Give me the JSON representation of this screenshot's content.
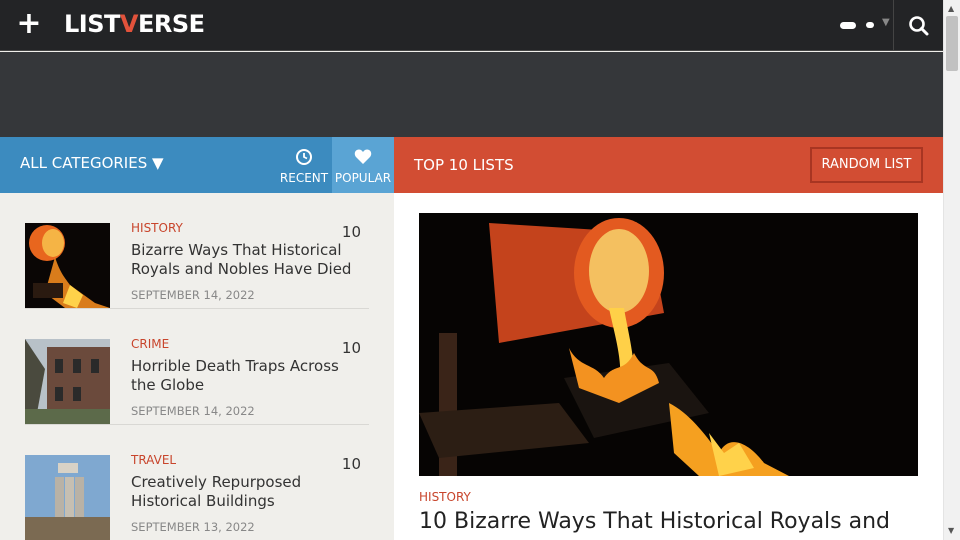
{
  "header": {
    "logo_prefix": "LIST",
    "logo_v": "V",
    "logo_suffix": "ERSE",
    "menu_icon": "plus-icon",
    "search_icon": "search-icon"
  },
  "nav": {
    "all_categories": "ALL CATEGORIES ▼",
    "recent": "RECENT",
    "popular": "POPULAR"
  },
  "featured_header": {
    "title": "TOP 10 LISTS",
    "random_button": "RANDOM LIST"
  },
  "list": [
    {
      "category": "HISTORY",
      "title": "Bizarre Ways That Historical Royals and Nobles Have Died",
      "date": "SEPTEMBER 14, 2022",
      "count": "10"
    },
    {
      "category": "CRIME",
      "title": "Horrible Death Traps Across the Globe",
      "date": "SEPTEMBER 14, 2022",
      "count": "10"
    },
    {
      "category": "TRAVEL",
      "title": "Creatively Repurposed Historical Buildings",
      "date": "SEPTEMBER 13, 2022",
      "count": "10"
    }
  ],
  "featured": {
    "category": "HISTORY",
    "title": "10 Bizarre Ways That Historical Royals and"
  },
  "colors": {
    "topbar": "#232426",
    "nav_blue": "#3c8bbf",
    "popular_blue": "#5aa4d4",
    "accent_red": "#d24d33",
    "category_red": "#c8452c"
  }
}
